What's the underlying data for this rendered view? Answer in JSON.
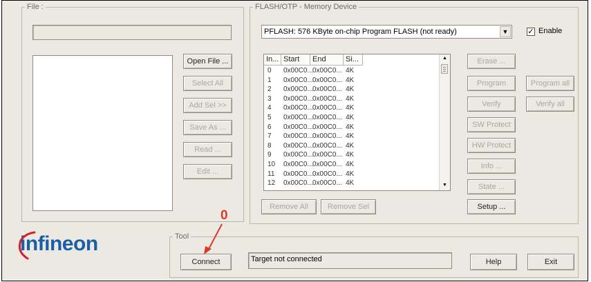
{
  "file_group": {
    "legend": "File :",
    "path_value": "",
    "buttons": {
      "open_file": "Open File ...",
      "select_all": "Select All",
      "add_sel": "Add Sel >>",
      "save_as": "Save As ...",
      "read": "Read ...",
      "edit": "Edit ..."
    }
  },
  "device_group": {
    "legend": "FLASH/OTP - Memory Device",
    "selected_device": "PFLASH: 576 KByte on-chip Program FLASH  (not ready)",
    "enable_label": "Enable",
    "enable_checked": true,
    "sector_table": {
      "columns": [
        "In...",
        "Start",
        "End",
        "Si..."
      ],
      "rows": [
        [
          "0",
          "0x00C0...",
          "0x00C0...",
          "4K"
        ],
        [
          "1",
          "0x00C0...",
          "0x00C0...",
          "4K"
        ],
        [
          "2",
          "0x00C0...",
          "0x00C0...",
          "4K"
        ],
        [
          "3",
          "0x00C0...",
          "0x00C0...",
          "4K"
        ],
        [
          "4",
          "0x00C0...",
          "0x00C0...",
          "4K"
        ],
        [
          "5",
          "0x00C0...",
          "0x00C0...",
          "4K"
        ],
        [
          "6",
          "0x00C0...",
          "0x00C0...",
          "4K"
        ],
        [
          "7",
          "0x00C0...",
          "0x00C0...",
          "4K"
        ],
        [
          "8",
          "0x00C0...",
          "0x00C0...",
          "4K"
        ],
        [
          "9",
          "0x00C0...",
          "0x00C0...",
          "4K"
        ],
        [
          "10",
          "0x00C0...",
          "0x00C0...",
          "4K"
        ],
        [
          "11",
          "0x00C0...",
          "0x00C0...",
          "4K"
        ],
        [
          "12",
          "0x00C0...",
          "0x00C0...",
          "4K"
        ]
      ]
    },
    "buttons": {
      "remove_all": "Remove All",
      "remove_sel": "Remove Sel",
      "erase": "Erase ...",
      "program": "Program",
      "program_all": "Program all",
      "verify": "Verify",
      "verify_all": "Verify all",
      "sw_protect": "SW Protect",
      "hw_protect": "HW Protect",
      "info": "Info ...",
      "state": "State ...",
      "setup": "Setup ..."
    }
  },
  "tool_group": {
    "legend": "Tool",
    "connect_label": "Connect",
    "status_text": "Target not connected",
    "help_label": "Help",
    "exit_label": "Exit"
  },
  "logo_text": "infineon",
  "annotation": {
    "marker_label": "0",
    "color": "#d93b25"
  },
  "icons": {
    "dropdown": "chevron-down-icon",
    "checkmark": "checkmark-icon",
    "scroll_up": "scroll-up-arrow-icon",
    "scroll_down": "scroll-down-arrow-icon"
  }
}
